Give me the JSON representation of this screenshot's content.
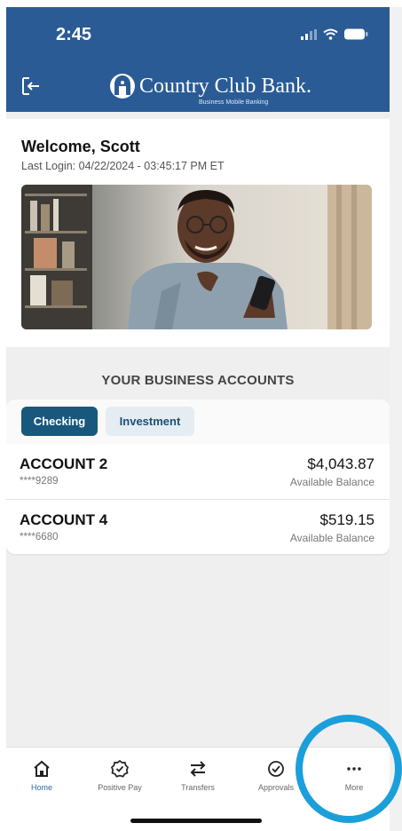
{
  "status_bar": {
    "time": "2:45"
  },
  "header": {
    "brand_name": "Country Club Bank.",
    "brand_sub": "Business Mobile Banking",
    "logout_icon": "logout-icon"
  },
  "welcome": {
    "title": "Welcome, Scott",
    "last_login": "Last Login: 04/22/2024 - 03:45:17 PM ET"
  },
  "accounts": {
    "heading": "YOUR BUSINESS ACCOUNTS",
    "tabs": [
      {
        "label": "Checking",
        "active": true
      },
      {
        "label": "Investment",
        "active": false
      }
    ],
    "items": [
      {
        "name": "ACCOUNT 2",
        "number": "****9289",
        "balance": "$4,043.87",
        "balance_label": "Available Balance"
      },
      {
        "name": "ACCOUNT 4",
        "number": "****6680",
        "balance": "$519.15",
        "balance_label": "Available Balance"
      }
    ]
  },
  "bottom_nav": {
    "items": [
      {
        "label": "Home",
        "icon": "home-icon",
        "active": true
      },
      {
        "label": "Positive Pay",
        "icon": "badge-check-icon",
        "active": false
      },
      {
        "label": "Transfers",
        "icon": "transfer-arrows-icon",
        "active": false
      },
      {
        "label": "Approvals",
        "icon": "circle-check-icon",
        "active": false
      },
      {
        "label": "More",
        "icon": "more-dots-icon",
        "active": false
      }
    ]
  },
  "colors": {
    "header_blue": "#2a5b95",
    "tab_active": "#17587c",
    "highlight_ring": "#1a9fdb"
  }
}
